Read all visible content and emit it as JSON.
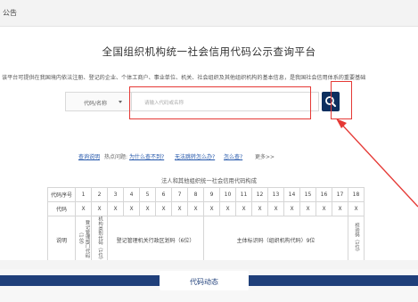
{
  "topbar": {
    "title": "公告"
  },
  "page": {
    "title": "全国组织机构统一社会信用代码公示查询平台",
    "intro": "该平台可提供在我国境内依法注册、登记的企业、个体工商户、事业单位、机关、社会组织及其他组织机构的基本信息，是我国社会信用体系的重要基础"
  },
  "search": {
    "type_label": "代码/名称",
    "placeholder": "请输入代码或名称",
    "button_icon": "search-icon"
  },
  "links": {
    "help": "查询说明",
    "hot_label": "热点问题:",
    "q1": "为什么查不到?",
    "q2": "无法跳转怎么办?",
    "q3": "怎么查?",
    "more": "更多>>"
  },
  "structure": {
    "title": "法人和其他组织统一社会信用代码构成",
    "row1_label": "代码序号",
    "row2_label": "代码",
    "row3_label": "说明",
    "positions": [
      "1",
      "2",
      "3",
      "4",
      "5",
      "6",
      "7",
      "8",
      "9",
      "10",
      "11",
      "12",
      "13",
      "14",
      "15",
      "16",
      "17",
      "18"
    ],
    "code_chars": [
      "X",
      "X",
      "X",
      "X",
      "X",
      "X",
      "X",
      "X",
      "X",
      "X",
      "X",
      "X",
      "X",
      "X",
      "X",
      "X",
      "X",
      "X"
    ],
    "desc_1": "登记管理部门代码（1位）",
    "desc_2": "机构类别代码（1位）",
    "desc_3": "登记管理机关行政区划码（6位）",
    "desc_4": "主体标识码（组织机构代码）9位",
    "desc_5": "校验码（1位）"
  },
  "section": {
    "label": "代码动态"
  },
  "colors": {
    "brand_navy": "#0d2f5f",
    "band_navy": "#1f3f7a",
    "highlight_red": "#e53935",
    "link_blue": "#2255aa"
  }
}
